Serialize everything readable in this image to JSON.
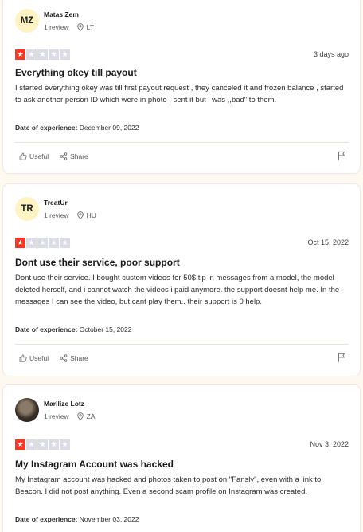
{
  "reviews": [
    {
      "avatar_initials": "MZ",
      "name": "Matas Zem",
      "review_count": "1 review",
      "country": "LT",
      "rating": 1,
      "date": "3 days ago",
      "title": "Everything okey till payout",
      "text": "I started everything okey was till first payout request , they canceled it and frozen balance , started to ask another person ID which were in photo , sent it but i was ,,bad\" to them.",
      "experience_label": "Date of experience:",
      "experience_date": "December 09, 2022",
      "useful_label": "Useful",
      "share_label": "Share"
    },
    {
      "avatar_initials": "TR",
      "name": "TreatUr",
      "review_count": "1 review",
      "country": "HU",
      "rating": 1,
      "date": "Oct 15, 2022",
      "title": "Dont use their service, poor support",
      "text": "Dont use their service. I bought custom videos for 50$ tip in messages from a model, the model deleted herself, and i cannot watch the videos i paid anymore. the support doesnt help me. In the messages I can see the video, but cant play them.. their support is 0 help.",
      "experience_label": "Date of experience:",
      "experience_date": "October 15, 2022",
      "useful_label": "Useful",
      "share_label": "Share"
    },
    {
      "avatar_initials": "",
      "name": "Marilize Lotz",
      "review_count": "1 review",
      "country": "ZA",
      "rating": 1,
      "date": "Nov 3, 2022",
      "title": "My Instagram Account was hacked",
      "text": "My Instagram account was hacked and photos taken to post on \"Fansly\", even with a link to Beacon. I did not post anything. Even a second scam profile on Instagram was created.",
      "experience_label": "Date of experience:",
      "experience_date": "November 03, 2022"
    }
  ]
}
